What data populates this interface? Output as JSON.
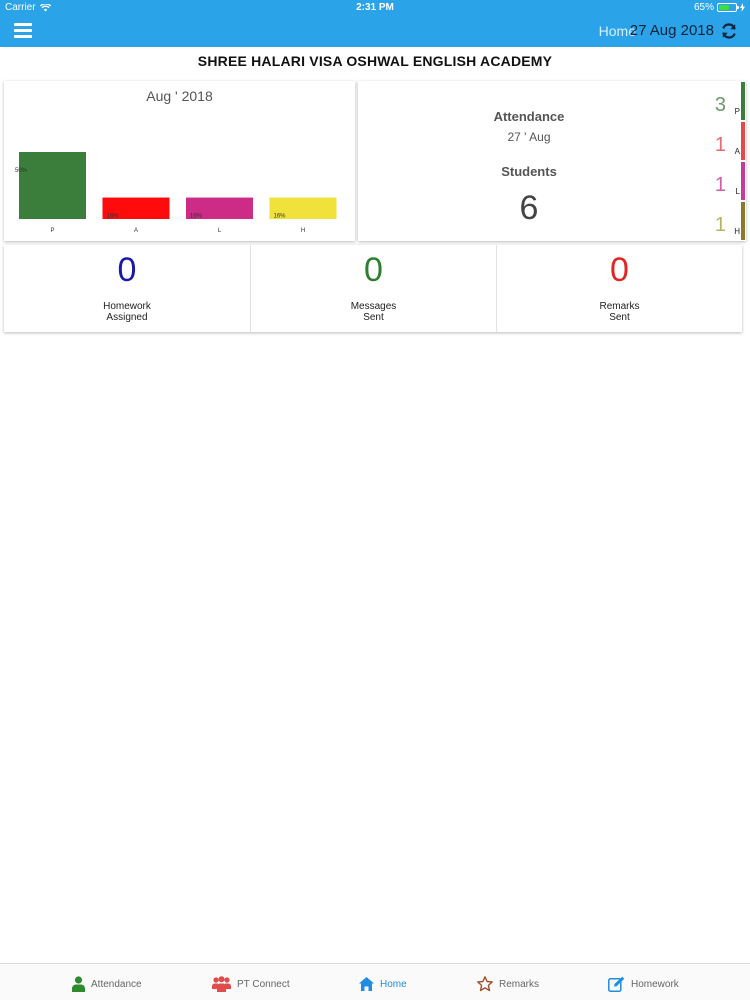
{
  "status_bar": {
    "carrier": "Carrier",
    "time": "2:31 PM",
    "battery": "65%",
    "battery_level": 0.65
  },
  "nav": {
    "title": "Home",
    "date": "27 Aug 2018"
  },
  "school_name": "SHREE HALARI VISA OSHWAL ENGLISH ACADEMY",
  "chart_data": {
    "type": "bar",
    "title": "Aug ' 2018",
    "categories": [
      "P",
      "A",
      "L",
      "H"
    ],
    "values": [
      50,
      16,
      16,
      16
    ],
    "data_labels": [
      "50%",
      "16%",
      "16%",
      "16%"
    ],
    "colors": [
      "#3b7d3a",
      "#ff0b0b",
      "#cc2b86",
      "#f0e23a"
    ],
    "ylim": [
      0,
      50
    ],
    "grid": false,
    "legend": "none"
  },
  "summary": {
    "attendance_label": "Attendance",
    "attendance_date": "27 ' Aug",
    "students_label": "Students",
    "students_count": "6",
    "statuses": [
      {
        "count": "3",
        "letter": "P",
        "color": "#3b7d3a",
        "text_color": "#6a9a69"
      },
      {
        "count": "1",
        "letter": "A",
        "color": "#e24b4b",
        "text_color": "#e8696f"
      },
      {
        "count": "1",
        "letter": "L",
        "color": "#c33ba0",
        "text_color": "#cf5fa9"
      },
      {
        "count": "1",
        "letter": "H",
        "color": "#8a7a2c",
        "text_color": "#b7b160"
      }
    ]
  },
  "stats": [
    {
      "value": "0",
      "line1": "Homework",
      "line2": "Assigned",
      "color": "#1a1aa8"
    },
    {
      "value": "0",
      "line1": "Messages",
      "line2": "Sent",
      "color": "#2f7d2f"
    },
    {
      "value": "0",
      "line1": "Remarks",
      "line2": "Sent",
      "color": "#e22424"
    }
  ],
  "tabs": [
    {
      "label": "Attendance",
      "icon": "person-icon",
      "color": "#2d8a2d"
    },
    {
      "label": "PT Connect",
      "icon": "group-icon",
      "color": "#e24b4b"
    },
    {
      "label": "Home",
      "icon": "home-icon",
      "color": "#1e8ee0"
    },
    {
      "label": "Remarks",
      "icon": "star-icon",
      "color": "#a0522d"
    },
    {
      "label": "Homework",
      "icon": "edit-icon",
      "color": "#1e8ee0"
    }
  ]
}
